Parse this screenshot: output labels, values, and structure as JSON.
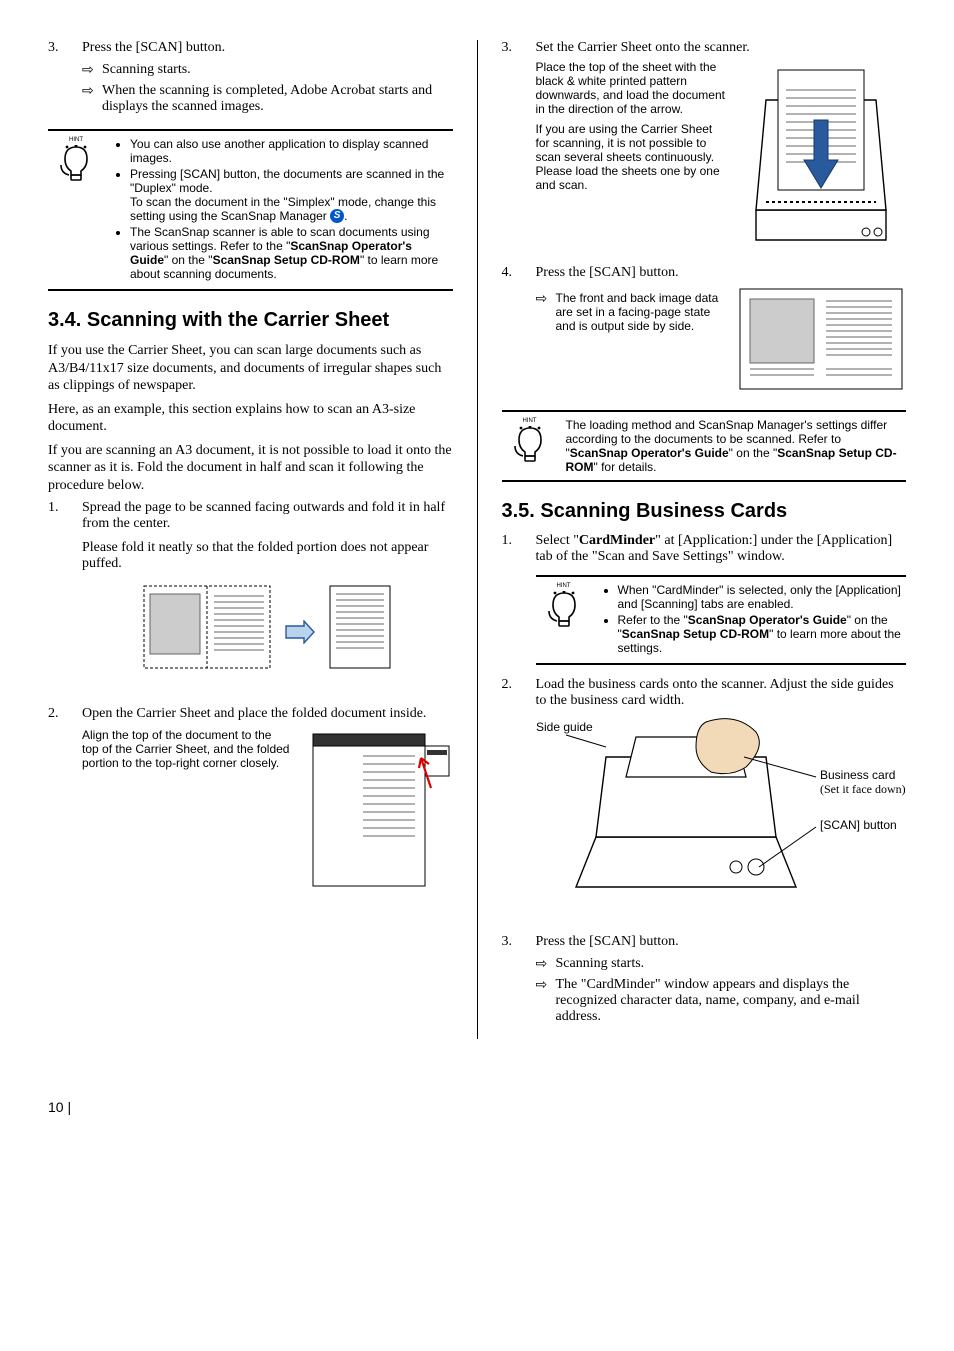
{
  "left": {
    "step3": {
      "num": "3.",
      "text": "Press the [SCAN] button.",
      "sub1": "Scanning starts.",
      "sub2": "When the scanning is completed, Adobe Acrobat starts and displays the scanned images."
    },
    "hint1": {
      "label": "HINT",
      "b1": "You can also use another application to display scanned images.",
      "b2a": "Pressing [SCAN] button, the documents are scanned in the \"Duplex\" mode.",
      "b2b": "To scan the document in the \"Simplex\" mode, change this setting using the ScanSnap Manager ",
      "b2c": ".",
      "b3a": "The ScanSnap scanner is able to scan documents using various settings. Refer to the \"",
      "b3b": "ScanSnap Operator's Guide",
      "b3c": "\" on the \"",
      "b3d": "ScanSnap Setup CD-ROM",
      "b3e": "\" to learn more about scanning documents."
    },
    "h34": "3.4. Scanning with the Carrier Sheet",
    "p1": "If you use the Carrier Sheet, you can scan large documents such as A3/B4/11x17 size documents, and documents of irregular shapes such as clippings of newspaper.",
    "p2": "Here, as an example, this section explains how to scan an A3-size document.",
    "p3": "If you are scanning an A3 document, it is not possible to load it onto the scanner as it is. Fold the document in half and scan it following the procedure below.",
    "cs1": {
      "num": "1.",
      "text": "Spread the page to be scanned facing outwards and fold it in half from the center.",
      "note": "Please fold it neatly so that the folded portion does not appear puffed."
    },
    "cs2": {
      "num": "2.",
      "text": "Open the Carrier Sheet and place the folded document inside.",
      "note": "Align the top of the document to the top of the Carrier Sheet, and the folded portion to the top-right corner closely."
    }
  },
  "right": {
    "cs3": {
      "num": "3.",
      "text": "Set the Carrier Sheet onto the scanner.",
      "note1": "Place the top of the sheet with the black & white printed pattern downwards, and load the document in the direction of the arrow.",
      "note2": "If you are using the Carrier Sheet for scanning, it is not possible to scan several sheets continuously. Please load the sheets one by one and scan."
    },
    "cs4": {
      "num": "4.",
      "text": "Press the [SCAN] button.",
      "note": "The front and back image data are set in a facing-page state and is output side by side."
    },
    "hint2": {
      "label": "HINT",
      "a": "The loading method and ScanSnap Manager's settings differ according to the documents to be scanned. Refer to \"",
      "b": "ScanSnap Operator's Guide",
      "c": "\" on the \"",
      "d": "ScanSnap Setup CD-ROM",
      "e": "\" for details."
    },
    "h35": "3.5. Scanning Business Cards",
    "bc1": {
      "num": "1.",
      "a": "Select \"",
      "b": "CardMinder",
      "c": "\" at [Application:] under the [Application] tab of the \"Scan and Save Settings\" window."
    },
    "hint3": {
      "label": "HINT",
      "b1": "When \"CardMinder\" is selected, only the [Application] and [Scanning] tabs are enabled.",
      "b2a": "Refer to the \"",
      "b2b": "ScanSnap Operator's Guide",
      "b2c": "\" on the \"",
      "b2d": "ScanSnap Setup CD-ROM",
      "b2e": "\" to learn more about the settings."
    },
    "bc2": {
      "num": "2.",
      "text": "Load the business cards onto the scanner. Adjust the side guides to the business card width.",
      "lbl_side": "Side guide",
      "lbl_card": "Business card",
      "lbl_card2": "(Set it face down)",
      "lbl_scan": "[SCAN] button"
    },
    "bc3": {
      "num": "3.",
      "text": "Press the [SCAN] button.",
      "sub1": "Scanning starts.",
      "sub2": "The \"CardMinder\" window appears and displays the recognized character data, name, company, and e-mail address."
    }
  },
  "pagenum": "10 |"
}
